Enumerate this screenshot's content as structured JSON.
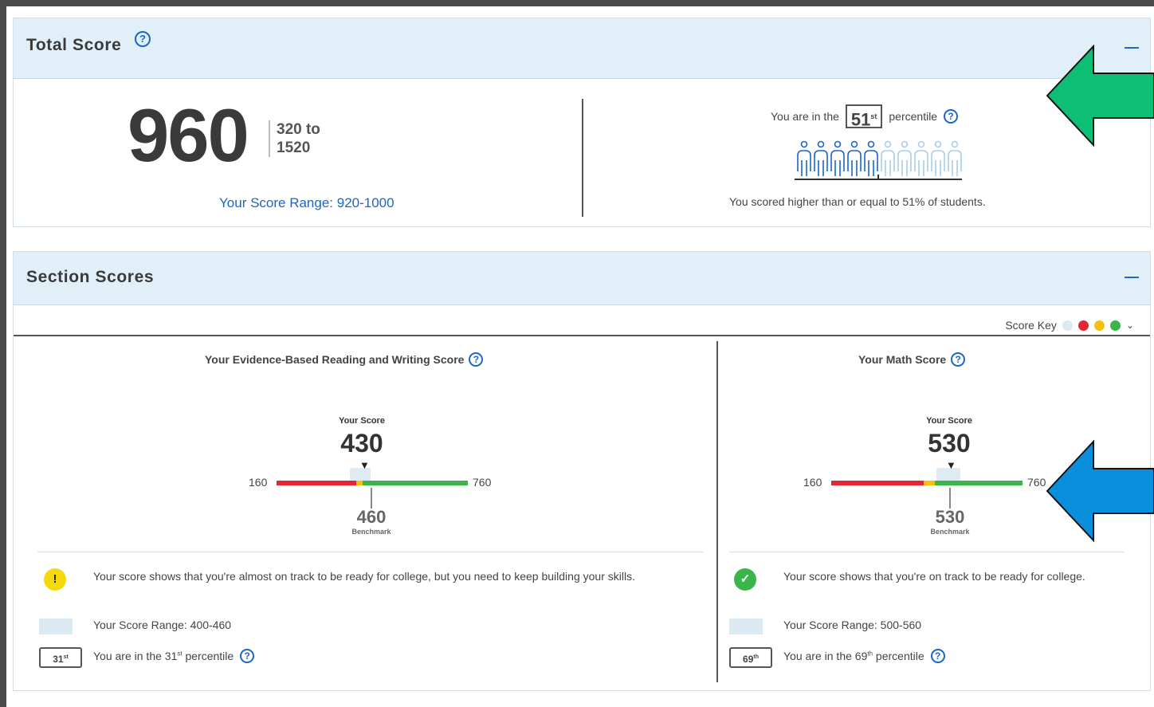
{
  "total": {
    "title": "Total Score",
    "help_icon": "question-circle-icon",
    "score": "960",
    "range_label": "320 to 1520",
    "score_range": "Your Score Range: 920-1000",
    "percentile_prefix": "You are in the",
    "percentile_value": "51",
    "percentile_suffix_sup": "st",
    "percentile_word": "percentile",
    "percentile_fraction": 0.51,
    "people_total": 10,
    "people_filled": 5,
    "percentile_sentence": "You scored higher than or equal to 51% of students."
  },
  "section": {
    "title": "Section Scores",
    "score_key_label": "Score Key",
    "score_key_colors": [
      "#dbe9f3",
      "#e32636",
      "#f4c20d",
      "#3ab54a"
    ],
    "ebrw": {
      "title": "Your Evidence-Based Reading and Writing Score",
      "your_score_label": "Your Score",
      "score": "430",
      "min": "160",
      "max": "760",
      "benchmark": "460",
      "benchmark_label": "Benchmark",
      "status": "warning",
      "message": "Your score shows that you're almost on track to be ready for college, but you need to keep building your skills.",
      "range_text": "Your Score Range: 400-460",
      "pct_value": "31",
      "pct_sup": "st",
      "pct_text_pre": "You are in the 31",
      "pct_text_sup": "st",
      "pct_text_post": "percentile"
    },
    "math": {
      "title": "Your Math Score",
      "your_score_label": "Your Score",
      "score": "530",
      "min": "160",
      "max": "760",
      "benchmark": "530",
      "benchmark_label": "Benchmark",
      "status": "on-track",
      "message": "Your score shows that you're on track to be ready for college.",
      "range_text": "Your Score Range: 500-560",
      "pct_value": "69",
      "pct_sup": "th",
      "pct_text_pre": "You are in the 69",
      "pct_text_sup": "th",
      "pct_text_post": "percentile"
    }
  },
  "annotations": {
    "arrow_top_color": "#0dbf74",
    "arrow_bottom_color": "#0a8fdc"
  }
}
